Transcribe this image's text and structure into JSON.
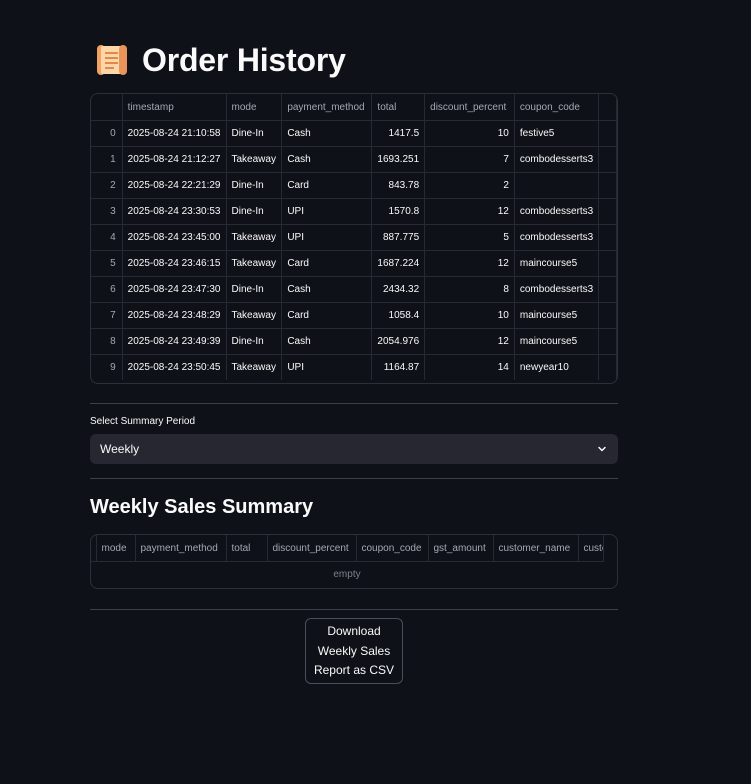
{
  "page": {
    "title": "Order History",
    "title_icon": "scroll-icon"
  },
  "orders_table": {
    "columns": [
      "timestamp",
      "mode",
      "payment_method",
      "total",
      "discount_percent",
      "coupon_code"
    ],
    "rows": [
      {
        "index": "0",
        "timestamp": "2025-08-24 21:10:58",
        "mode": "Dine-In",
        "payment_method": "Cash",
        "total": "1417.5",
        "discount_percent": "10",
        "coupon_code": "festive5"
      },
      {
        "index": "1",
        "timestamp": "2025-08-24 21:12:27",
        "mode": "Takeaway",
        "payment_method": "Cash",
        "total": "1693.251",
        "discount_percent": "7",
        "coupon_code": "combodesserts3"
      },
      {
        "index": "2",
        "timestamp": "2025-08-24 22:21:29",
        "mode": "Dine-In",
        "payment_method": "Card",
        "total": "843.78",
        "discount_percent": "2",
        "coupon_code": ""
      },
      {
        "index": "3",
        "timestamp": "2025-08-24 23:30:53",
        "mode": "Dine-In",
        "payment_method": "UPI",
        "total": "1570.8",
        "discount_percent": "12",
        "coupon_code": "combodesserts3"
      },
      {
        "index": "4",
        "timestamp": "2025-08-24 23:45:00",
        "mode": "Takeaway",
        "payment_method": "UPI",
        "total": "887.775",
        "discount_percent": "5",
        "coupon_code": "combodesserts3"
      },
      {
        "index": "5",
        "timestamp": "2025-08-24 23:46:15",
        "mode": "Takeaway",
        "payment_method": "Card",
        "total": "1687.224",
        "discount_percent": "12",
        "coupon_code": "maincourse5"
      },
      {
        "index": "6",
        "timestamp": "2025-08-24 23:47:30",
        "mode": "Dine-In",
        "payment_method": "Cash",
        "total": "2434.32",
        "discount_percent": "8",
        "coupon_code": "combodesserts3"
      },
      {
        "index": "7",
        "timestamp": "2025-08-24 23:48:29",
        "mode": "Takeaway",
        "payment_method": "Card",
        "total": "1058.4",
        "discount_percent": "10",
        "coupon_code": "maincourse5"
      },
      {
        "index": "8",
        "timestamp": "2025-08-24 23:49:39",
        "mode": "Dine-In",
        "payment_method": "Cash",
        "total": "2054.976",
        "discount_percent": "12",
        "coupon_code": "maincourse5"
      },
      {
        "index": "9",
        "timestamp": "2025-08-24 23:50:45",
        "mode": "Takeaway",
        "payment_method": "UPI",
        "total": "1164.87",
        "discount_percent": "14",
        "coupon_code": "newyear10"
      }
    ]
  },
  "summary_select": {
    "label": "Select Summary Period",
    "value": "Weekly",
    "icon": "chevron-down-icon"
  },
  "summary": {
    "title": "Weekly Sales Summary",
    "columns": [
      "mode",
      "payment_method",
      "total",
      "discount_percent",
      "coupon_code",
      "gst_amount",
      "customer_name",
      "custo"
    ],
    "empty_text": "empty"
  },
  "download_button": {
    "line1": "Download",
    "line2": "Weekly Sales",
    "line3": "Report as CSV"
  }
}
